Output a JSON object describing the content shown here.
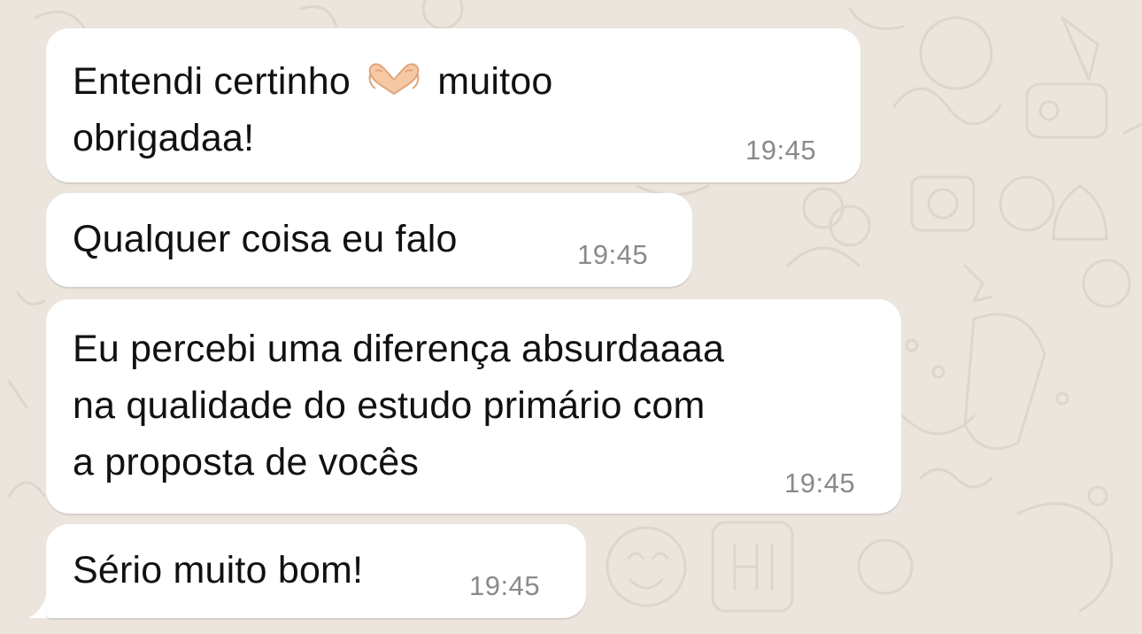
{
  "chat": {
    "messages": [
      {
        "line1_before": "Entendi certinho ",
        "emoji": "heart-hands-emoji",
        "line1_after": " muitoo",
        "line2": "obrigadaa!",
        "time": "19:45"
      },
      {
        "text": "Qualquer coisa eu falo",
        "time": "19:45"
      },
      {
        "text": "Eu percebi uma diferença absurdaaaa\nna qualidade do estudo primário com\na proposta de vocês",
        "time": "19:45"
      },
      {
        "text": "Sério muito bom!",
        "time": "19:45"
      }
    ]
  },
  "colors": {
    "wallpaper": "#ece5dd",
    "bubble": "#ffffff",
    "time": "#8a8a8a"
  }
}
